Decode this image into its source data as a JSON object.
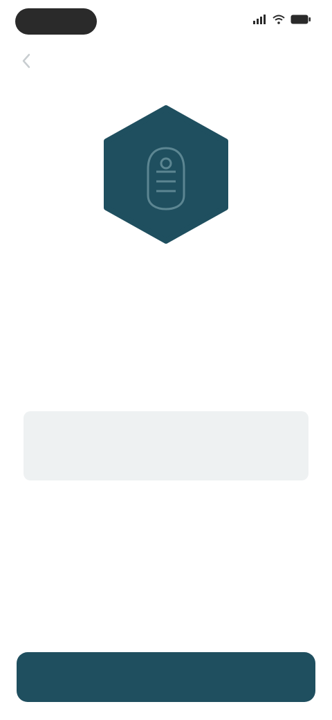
{
  "status_bar": {
    "time": "",
    "signal_icon": "signal-icon",
    "wifi_icon": "wifi-icon",
    "battery_icon": "battery-icon"
  },
  "nav": {
    "back_icon": "chevron-left-icon"
  },
  "emblem": {
    "icon": "shield-icon",
    "color": "#1f4f5f"
  },
  "content": {
    "title": "",
    "description": "",
    "note": "",
    "link_label": ""
  },
  "footer": {
    "primary_button_label": ""
  },
  "colors": {
    "primary": "#1f4f5f",
    "note_background": "#eef1f2"
  }
}
